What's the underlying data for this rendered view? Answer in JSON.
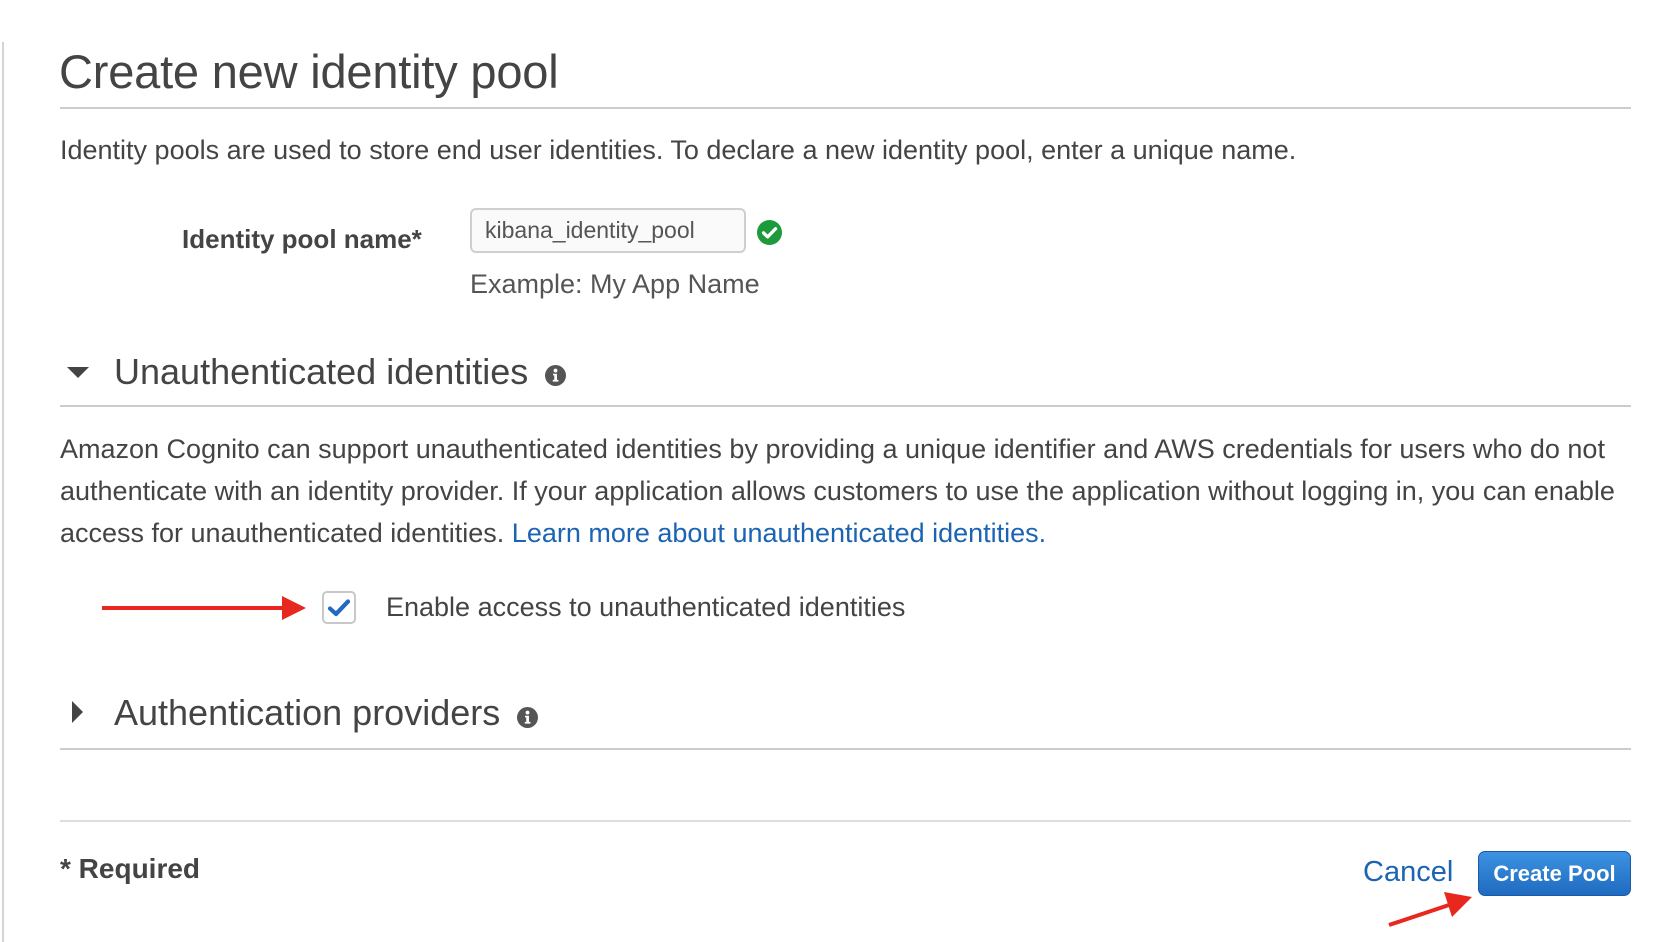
{
  "page": {
    "title": "Create new identity pool",
    "intro": "Identity pools are used to store end user identities. To declare a new identity pool, enter a unique name."
  },
  "pool_name_field": {
    "label": "Identity pool name*",
    "value": "kibana_identity_pool",
    "hint": "Example: My App Name",
    "status_icon": "check-circle-icon",
    "status_color": "#1d9a3c"
  },
  "unauth_section": {
    "title": "Unauthenticated identities",
    "expanded": true,
    "toggle_icon": "caret-down-icon",
    "info_icon": "info-icon",
    "description": "Amazon Cognito can support unauthenticated identities by providing a unique identifier and AWS credentials for users who do not authenticate with an identity provider. If your application allows customers to use the application without logging in, you can enable access for unauthenticated identities.",
    "link_text": "Learn more about unauthenticated identities.",
    "checkbox_label": "Enable access to unauthenticated identities",
    "checkbox_checked": true
  },
  "auth_providers_section": {
    "title": "Authentication providers",
    "expanded": false,
    "toggle_icon": "caret-right-icon",
    "info_icon": "info-icon"
  },
  "footer": {
    "required_note": "* Required",
    "cancel_label": "Cancel",
    "create_label": "Create Pool"
  },
  "annotations": {
    "arrow_color": "#e8281e",
    "arrows": [
      "points-to-enable-checkbox",
      "points-to-create-pool-button"
    ]
  },
  "colors": {
    "link": "#1b64b3",
    "primary_button": "#2a7ad0",
    "text": "#444444"
  }
}
